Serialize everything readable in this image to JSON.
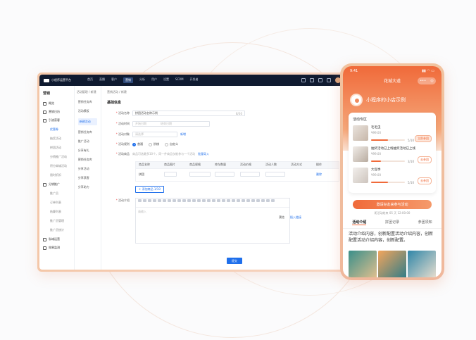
{
  "desktop": {
    "topbar": {
      "app_name": "小程序运营平台",
      "nav": [
        "首页",
        "直播",
        "客户",
        "营销",
        "分析",
        "用户",
        "设置",
        "SCRM",
        "开发者"
      ],
      "active_index": 3
    },
    "sidebar": {
      "title": "营销",
      "groups": [
        {
          "label": "概览",
          "items": []
        },
        {
          "label": "营销日历",
          "items": []
        },
        {
          "label": "引流获客",
          "items": [
            "优惠券",
            "抽奖活动",
            "拼团活动",
            "分销推广活动",
            "积分商城活动",
            "限时折扣"
          ]
        },
        {
          "label": "分销推广",
          "items": [
            "推广员",
            "订单列表",
            "结算列表",
            "推广员管理",
            "推广员统计"
          ]
        },
        {
          "label": "私域运营",
          "items": []
        },
        {
          "label": "效果监测",
          "items": []
        }
      ],
      "active_item": "优惠券"
    },
    "subnav": {
      "breadcrumb": "活动管理 / 新建",
      "items": [
        "营销任务库",
        "活动模板",
        "新建活动",
        "营销任务库",
        "推广活动",
        "分享有礼",
        "营销任务库",
        "分享活动",
        "分享获客",
        "分享助力"
      ],
      "active_index": 2
    },
    "form": {
      "breadcrumb": "营销活动 / 新建",
      "section_title": "基础信息",
      "activity_name_label": "活动名称",
      "activity_name_value": "拼团活动名称示例",
      "activity_name_count": "8/30",
      "activity_time_label": "活动时间",
      "activity_time_start": "开始日期",
      "activity_time_end": "结束日期",
      "audience_label": "活动对象",
      "audience_placeholder": "请选择",
      "audience_link": "新增",
      "rule_label": "活动规则",
      "rule_options": [
        "普通",
        "阶梯",
        "自定义"
      ],
      "rule_selected_index": 0,
      "products_label": "活动商品",
      "products_hint": "商品可选最多10个，同一件商品仅能参与一个活动",
      "products_link": "批量导入",
      "table_headers": [
        "商品名称",
        "商品图片",
        "商品规格",
        "库存数量",
        "活动价格",
        "活动人数",
        "活动方式",
        "操作"
      ],
      "table_row": {
        "name": "拼团",
        "action": "删除"
      },
      "add_button": "+ 添加商品 1/10",
      "desc_label": "活动介绍",
      "desc_tab_preview": "预览",
      "desc_tab_link": "插入链接",
      "desc_placeholder": "请输入",
      "submit": "提交"
    }
  },
  "phone": {
    "status_time": "9:41",
    "title": "花城大道",
    "shop_name": "小程序的小店示例",
    "section_title": "活动专区",
    "products": [
      {
        "name": "毛毛虫",
        "price": "¥99.00",
        "count": "5/10",
        "progress": 0.5,
        "button": "立即参团",
        "solid": true
      },
      {
        "name": "抽奖活动已上线抽奖活动已上线",
        "price": "¥99.00",
        "count": "3/10",
        "progress": 0.3,
        "button": "去参团",
        "solid": false
      },
      {
        "name": "大促季",
        "price": "¥99.00",
        "count": "5/10",
        "progress": 0.5,
        "button": "去参团",
        "solid": false
      }
    ],
    "cta": "邀请好友来参与活动",
    "countdown": "距活动结束 05 天 12:00:00",
    "tabs": [
      "活动介绍",
      "拼团记录",
      "参团须知"
    ],
    "active_tab": 0,
    "description": "活动介绍内容，创新配置活动介绍内容，创新配置活动介绍内容，创新配置。"
  }
}
